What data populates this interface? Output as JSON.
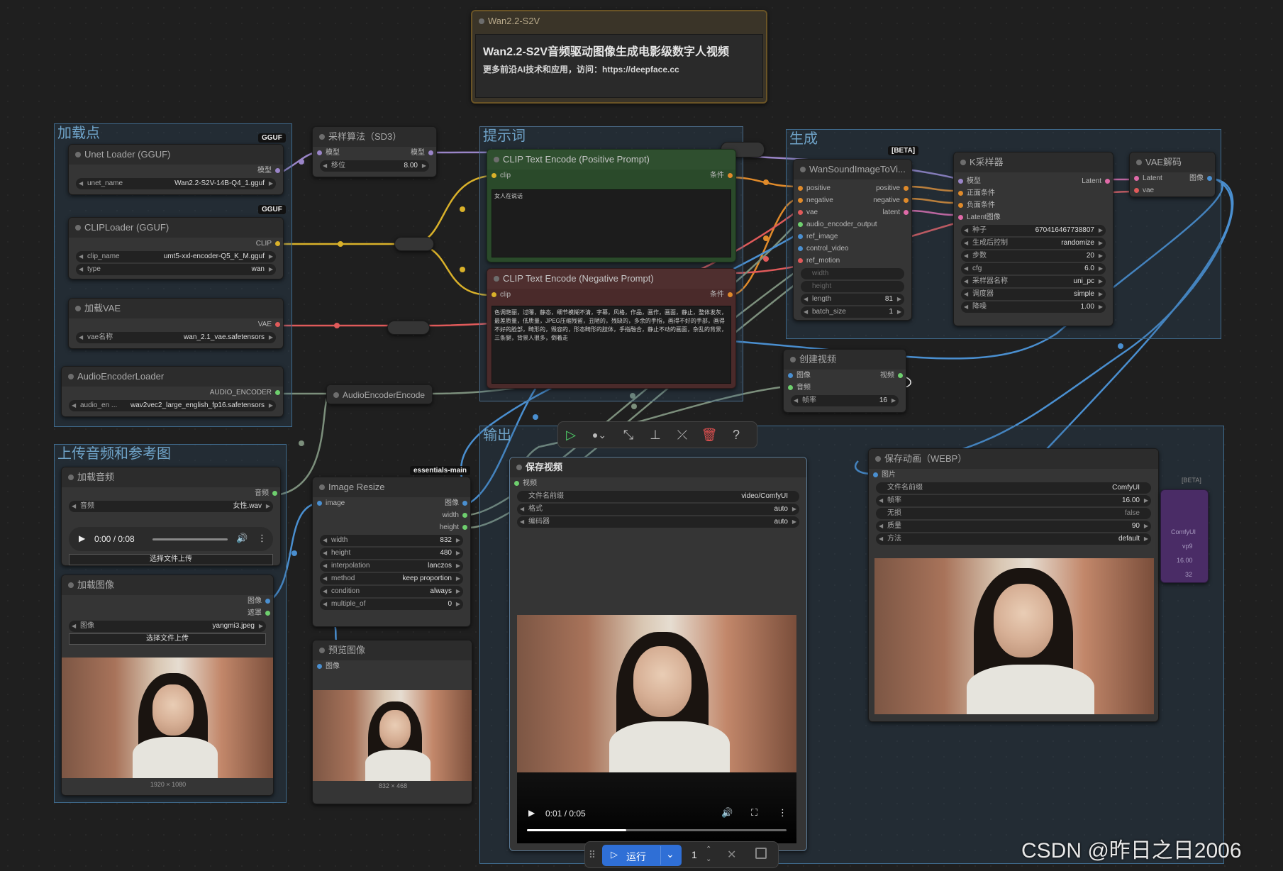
{
  "watermark": "CSDN @昨日之日2006",
  "title_node": {
    "header": "Wan2.2-S2V",
    "title": "Wan2.2-S2V音频驱动图像生成电影级数字人视频",
    "subtitle": "更多前沿AI技术和应用，访问：https://deepface.cc"
  },
  "groups": {
    "load": "加载点",
    "upload": "上传音频和参考图",
    "prompt": "提示词",
    "generate": "生成",
    "output": "输出"
  },
  "unet": {
    "title": "Unet Loader (GGUF)",
    "badge": "GGUF",
    "out": "模型",
    "w_label": "unet_name",
    "w_value": "Wan2.2-S2V-14B-Q4_1.gguf"
  },
  "cliploader": {
    "title": "CLIPLoader (GGUF)",
    "badge": "GGUF",
    "out": "CLIP",
    "w1_label": "clip_name",
    "w1_value": "umt5-xxl-encoder-Q5_K_M.gguf",
    "w2_label": "type",
    "w2_value": "wan"
  },
  "vae_loader": {
    "title": "加载VAE",
    "out": "VAE",
    "w_label": "vae名称",
    "w_value": "wan_2.1_vae.safetensors"
  },
  "audio_loader": {
    "title": "AudioEncoderLoader",
    "out": "AUDIO_ENCODER",
    "w_label": "audio_en ...",
    "w_value": "wav2vec2_large_english_fp16.safetensors"
  },
  "sampling": {
    "title": "采样算法（SD3）",
    "in": "模型",
    "out": "模型",
    "w_label": "移位",
    "w_value": "8.00"
  },
  "audio_encode": {
    "title": "AudioEncoderEncode"
  },
  "clip_pos": {
    "title": "CLIP Text Encode (Positive Prompt)",
    "in": "clip",
    "out": "条件",
    "text": "女人在说话"
  },
  "clip_neg": {
    "title": "CLIP Text Encode (Negative Prompt)",
    "in": "clip",
    "out": "条件",
    "text": "色调艳丽，过曝，静态，细节模糊不清，字幕，风格，作品，画作，画面，静止，整体发灰，最差质量，低质量，JPEG压缩残留，丑陋的，残缺的，多余的手指，画得不好的手部，画得不好的脸部，畸形的，毁容的，形态畸形的肢体，手指融合，静止不动的画面，杂乱的背景，三条腿，背景人很多，倒着走"
  },
  "wan_node": {
    "title": "WanSoundImageToVi...",
    "badge": "[BETA]",
    "inputs": [
      "positive",
      "negative",
      "vae",
      "audio_encoder_output",
      "ref_image",
      "control_video",
      "ref_motion"
    ],
    "outputs": [
      "positive",
      "negative",
      "latent"
    ],
    "disabled": [
      "width",
      "height"
    ],
    "w1_label": "length",
    "w1_value": "81",
    "w2_label": "batch_size",
    "w2_value": "1"
  },
  "ksampler": {
    "title": "K采样器",
    "inputs": [
      "模型",
      "正面条件",
      "负面条件",
      "Latent图像"
    ],
    "out": "Latent",
    "widgets": [
      {
        "label": "种子",
        "value": "670416467738807"
      },
      {
        "label": "生成后控制",
        "value": "randomize"
      },
      {
        "label": "步数",
        "value": "20"
      },
      {
        "label": "cfg",
        "value": "6.0"
      },
      {
        "label": "采样器名称",
        "value": "uni_pc"
      },
      {
        "label": "调度器",
        "value": "simple"
      },
      {
        "label": "降噪",
        "value": "1.00"
      }
    ]
  },
  "vae_decode": {
    "title": "VAE解码",
    "in1": "Latent",
    "in2": "vae",
    "out": "图像"
  },
  "create_video": {
    "title": "创建视频",
    "in1": "图像",
    "in2": "音频",
    "out": "视频",
    "w_label": "帧率",
    "w_value": "16"
  },
  "load_audio": {
    "title": "加载音频",
    "out": "音频",
    "w_label": "音频",
    "w_value": "女性.wav",
    "time": "0:00 / 0:08",
    "upload": "选择文件上传"
  },
  "load_image": {
    "title": "加载图像",
    "out1": "图像",
    "out2": "遮罩",
    "w_label": "图像",
    "w_value": "yangmi3.jpeg",
    "upload": "选择文件上传",
    "dims": "1920 × 1080"
  },
  "resize": {
    "title": "Image Resize",
    "badge": "essentials-main",
    "in": "image",
    "outputs": [
      "图像",
      "width",
      "height"
    ],
    "widgets": [
      {
        "label": "width",
        "value": "832"
      },
      {
        "label": "height",
        "value": "480"
      },
      {
        "label": "interpolation",
        "value": "lanczos"
      },
      {
        "label": "method",
        "value": "keep proportion"
      },
      {
        "label": "condition",
        "value": "always"
      },
      {
        "label": "multiple_of",
        "value": "0"
      }
    ]
  },
  "preview": {
    "title": "预览图像",
    "in": "图像",
    "dims": "832 × 468"
  },
  "save_video": {
    "title": "保存视频",
    "in": "视频",
    "widgets": [
      {
        "label": "文件名前缀",
        "value": "video/ComfyUI"
      },
      {
        "label": "格式",
        "value": "auto"
      },
      {
        "label": "编码器",
        "value": "auto"
      }
    ],
    "time": "0:01 / 0:05"
  },
  "save_anim": {
    "title": "保存动画（WEBP）",
    "badge": "[BETA]",
    "in": "图片",
    "widgets": [
      {
        "label": "文件名前缀",
        "value": "ComfyUI"
      },
      {
        "label": "帧率",
        "value": "16.00"
      },
      {
        "label": "无损",
        "value": "false"
      },
      {
        "label": "质量",
        "value": "90"
      },
      {
        "label": "方法",
        "value": "default"
      }
    ]
  },
  "ghost_node": {
    "v1": "ComfyUI",
    "v2": "vp9",
    "v3": "16.00",
    "v4": "32"
  },
  "run_bar": {
    "run_label": "运行",
    "count": "1"
  }
}
